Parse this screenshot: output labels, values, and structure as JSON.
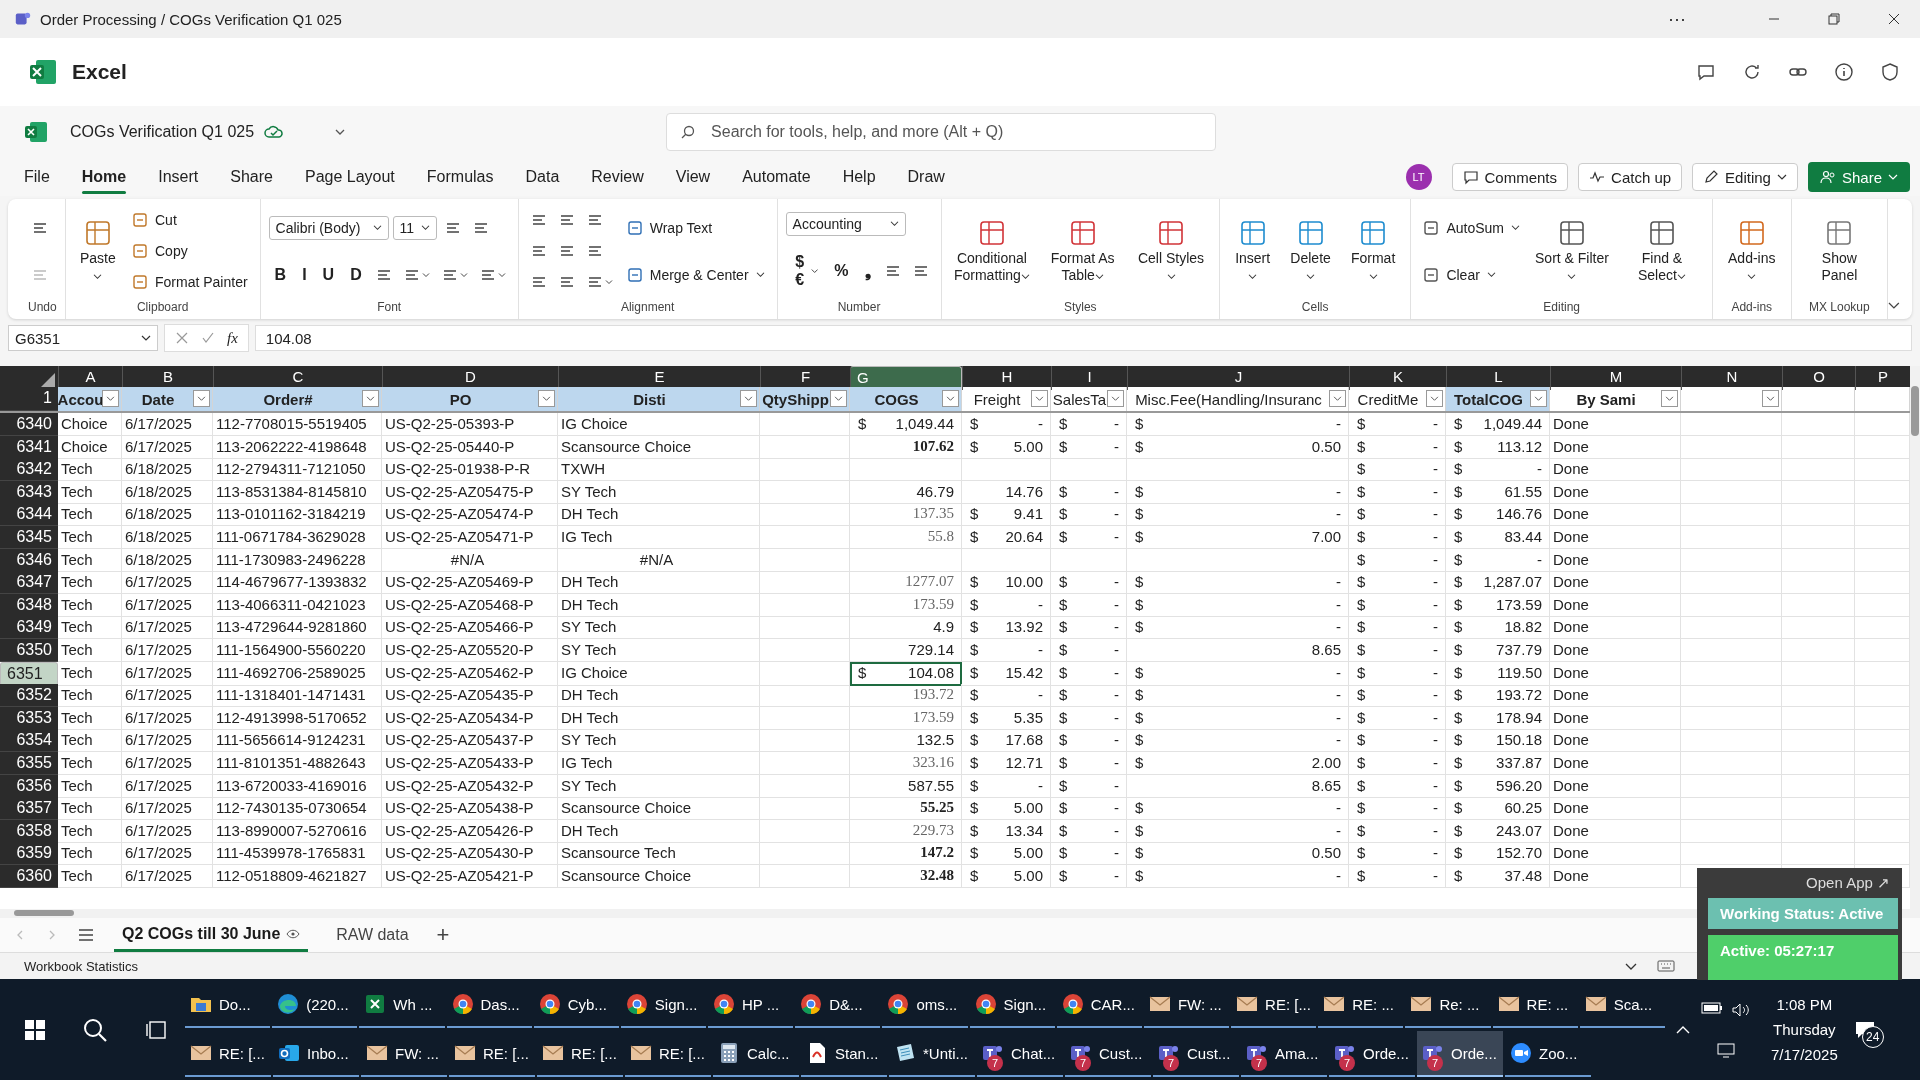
{
  "window": {
    "title": "Order Processing / COGs Verification Q1 025",
    "more": "···"
  },
  "app": {
    "name": "Excel"
  },
  "document": {
    "name": "COGs Verification Q1 025",
    "search_placeholder": "Search for tools, help, and more (Alt + Q)"
  },
  "menu": {
    "tabs": [
      {
        "label": "File",
        "selected": false
      },
      {
        "label": "Home",
        "selected": true
      },
      {
        "label": "Insert",
        "selected": false
      },
      {
        "label": "Share",
        "selected": false
      },
      {
        "label": "Page Layout",
        "selected": false
      },
      {
        "label": "Formulas",
        "selected": false
      },
      {
        "label": "Data",
        "selected": false
      },
      {
        "label": "Review",
        "selected": false
      },
      {
        "label": "View",
        "selected": false
      },
      {
        "label": "Automate",
        "selected": false
      },
      {
        "label": "Help",
        "selected": false
      },
      {
        "label": "Draw",
        "selected": false
      }
    ],
    "avatar": "LT",
    "comments": "Comments",
    "catch_up": "Catch up",
    "mode": "Editing",
    "share": "Share"
  },
  "ribbon": {
    "groups": [
      {
        "label": "Undo",
        "columns": [
          [
            [
              {
                "kind": "icon",
                "disabled": false
              }
            ],
            [
              {
                "kind": "icon",
                "disabled": true
              }
            ]
          ]
        ]
      },
      {
        "label": "Clipboard",
        "columns": [
          [
            [
              {
                "kind": "large",
                "label": "Paste",
                "dropdown": true
              }
            ]
          ],
          [
            [
              {
                "kind": "small",
                "label": "Cut"
              }
            ],
            [
              {
                "kind": "small",
                "label": "Copy"
              }
            ],
            [
              {
                "kind": "small",
                "label": "Format Painter"
              }
            ]
          ]
        ]
      },
      {
        "label": "Font",
        "columns": [
          [
            [
              {
                "kind": "select",
                "label": "Calibri (Body)",
                "wide": true
              },
              {
                "kind": "select",
                "label": "11",
                "wide": false
              },
              {
                "kind": "icon"
              },
              {
                "kind": "icon"
              }
            ],
            [
              {
                "kind": "glyph",
                "label": "B"
              },
              {
                "kind": "glyph",
                "label": "I"
              },
              {
                "kind": "glyph",
                "label": "U"
              },
              {
                "kind": "glyph",
                "label": "D"
              },
              {
                "kind": "icon"
              },
              {
                "kind": "icon",
                "dropdown": true
              },
              {
                "kind": "icon",
                "dropdown": true
              },
              {
                "kind": "icon",
                "dropdown": true
              }
            ]
          ]
        ]
      },
      {
        "label": "Alignment",
        "columns": [
          [
            [
              {
                "kind": "icon"
              },
              {
                "kind": "icon"
              },
              {
                "kind": "icon"
              }
            ],
            [
              {
                "kind": "icon"
              },
              {
                "kind": "icon"
              },
              {
                "kind": "icon"
              }
            ],
            [
              {
                "kind": "icon"
              },
              {
                "kind": "icon"
              },
              {
                "kind": "icon",
                "dropdown": true
              }
            ]
          ],
          [
            [
              {
                "kind": "small",
                "label": "Wrap Text"
              }
            ],
            [
              {
                "kind": "small",
                "label": "Merge & Center",
                "dropdown": true
              }
            ]
          ]
        ]
      },
      {
        "label": "Number",
        "columns": [
          [
            [
              {
                "kind": "select",
                "label": "Accounting",
                "wide": true
              }
            ],
            [
              {
                "kind": "glyph",
                "label": "$€",
                "dropdown": true
              },
              {
                "kind": "glyph",
                "label": "%"
              },
              {
                "kind": "glyph",
                "label": "❟"
              },
              {
                "kind": "icon"
              },
              {
                "kind": "icon"
              }
            ]
          ]
        ]
      },
      {
        "label": "Styles",
        "columns": [
          [
            [
              {
                "kind": "large",
                "label": "Conditional Formatting",
                "dropdown": true
              }
            ]
          ],
          [
            [
              {
                "kind": "large",
                "label": "Format As Table",
                "dropdown": true
              }
            ]
          ],
          [
            [
              {
                "kind": "large",
                "label": "Cell Styles",
                "dropdown": true
              }
            ]
          ]
        ]
      },
      {
        "label": "Cells",
        "columns": [
          [
            [
              {
                "kind": "large",
                "label": "Insert",
                "dropdown": true
              }
            ]
          ],
          [
            [
              {
                "kind": "large",
                "label": "Delete",
                "dropdown": true
              }
            ]
          ],
          [
            [
              {
                "kind": "large",
                "label": "Format",
                "dropdown": true
              }
            ]
          ]
        ]
      },
      {
        "label": "Editing",
        "columns": [
          [
            [
              {
                "kind": "small",
                "label": "AutoSum",
                "dropdown": true
              }
            ],
            [
              {
                "kind": "small",
                "label": "Clear",
                "dropdown": true
              }
            ]
          ],
          [
            [
              {
                "kind": "large",
                "label": "Sort & Filter",
                "dropdown": true
              }
            ]
          ],
          [
            [
              {
                "kind": "large",
                "label": "Find & Select",
                "dropdown": true
              }
            ]
          ]
        ]
      },
      {
        "label": "Add-ins",
        "columns": [
          [
            [
              {
                "kind": "large",
                "label": "Add-ins",
                "dropdown": true
              }
            ]
          ]
        ]
      },
      {
        "label": "MX Lookup",
        "columns": [
          [
            [
              {
                "kind": "large",
                "label": "Show Panel"
              }
            ]
          ]
        ]
      }
    ]
  },
  "formula_bar": {
    "cell": "G6351",
    "fx": "fx",
    "value": "104.08"
  },
  "sheet": {
    "corner_row": "1",
    "columns": [
      {
        "letter": "A",
        "header": "Accou",
        "filter": true,
        "bold": true,
        "filled": true,
        "selected": false
      },
      {
        "letter": "B",
        "header": "Date",
        "filter": true,
        "bold": true,
        "filled": true,
        "selected": false
      },
      {
        "letter": "C",
        "header": "Order#",
        "filter": true,
        "bold": true,
        "filled": true,
        "selected": false
      },
      {
        "letter": "D",
        "header": "PO",
        "filter": true,
        "bold": true,
        "filled": true,
        "selected": false
      },
      {
        "letter": "E",
        "header": "Disti",
        "filter": true,
        "bold": true,
        "filled": true,
        "selected": false
      },
      {
        "letter": "F",
        "header": "QtyShipp",
        "filter": true,
        "bold": true,
        "filled": true,
        "selected": false
      },
      {
        "letter": "G",
        "header": "COGS",
        "filter": true,
        "bold": true,
        "filled": true,
        "selected": true
      },
      {
        "letter": "H",
        "header": "Freight",
        "filter": true,
        "bold": false,
        "filled": false,
        "selected": false
      },
      {
        "letter": "I",
        "header": "SalesTa",
        "filter": true,
        "bold": false,
        "filled": false,
        "selected": false
      },
      {
        "letter": "J",
        "header": "Misc.Fee(Handling/Insuranc",
        "filter": true,
        "bold": false,
        "filled": false,
        "selected": false
      },
      {
        "letter": "K",
        "header": "CreditMe",
        "filter": true,
        "bold": false,
        "filled": false,
        "selected": false
      },
      {
        "letter": "L",
        "header": "TotalCOG",
        "filter": true,
        "bold": true,
        "filled": true,
        "selected": false
      },
      {
        "letter": "M",
        "header": "By Sami",
        "filter": true,
        "bold": true,
        "filled": false,
        "selected": false
      },
      {
        "letter": "N",
        "filter": true,
        "filled": false,
        "selected": false
      },
      {
        "letter": "O",
        "filter": false,
        "filled": false,
        "selected": false
      },
      {
        "letter": "P",
        "filter": false,
        "filled": false,
        "selected": false
      }
    ],
    "rows": [
      {
        "row": "6340",
        "selected": false,
        "cells": [
          "Choice",
          "6/17/2025",
          "112-7708015-5519405",
          "US-Q2-25-05393-P",
          "IG Choice",
          "",
          {
            "cur": "$",
            "val": "1,049.44"
          },
          {
            "cur": "$",
            "val": "-"
          },
          {
            "cur": "$",
            "val": "-"
          },
          {
            "cur": "$",
            "val": "-"
          },
          {
            "cur": "$",
            "val": "-"
          },
          {
            "cur": "$",
            "val": "1,049.44"
          },
          "Done"
        ]
      },
      {
        "row": "6341",
        "selected": false,
        "cells": [
          "Choice",
          "6/17/2025",
          "113-2062222-4198648",
          "US-Q2-25-05440-P",
          "Scansource Choice",
          "",
          {
            "val": "107.62",
            "kind": "bold"
          },
          {
            "cur": "$",
            "val": "5.00"
          },
          {
            "cur": "$",
            "val": "-"
          },
          {
            "cur": "$",
            "val": "0.50"
          },
          {
            "cur": "$",
            "val": "-"
          },
          {
            "cur": "$",
            "val": "113.12"
          },
          "Done"
        ]
      },
      {
        "row": "6342",
        "selected": false,
        "cells": [
          "Tech",
          "6/18/2025",
          "112-2794311-7121050",
          "US-Q2-25-01938-P-R",
          "TXWH",
          "",
          "",
          "",
          "",
          "",
          {
            "cur": "$",
            "val": "-"
          },
          {
            "cur": "$",
            "val": "-"
          },
          "Done"
        ]
      },
      {
        "row": "6343",
        "selected": false,
        "cells": [
          "Tech",
          "6/18/2025",
          "113-8531384-8145810",
          "US-Q2-25-AZ05475-P",
          "SY Tech",
          "",
          {
            "val": "46.79"
          },
          {
            "val": "14.76"
          },
          {
            "cur": "$",
            "val": "-"
          },
          {
            "cur": "$",
            "val": "-"
          },
          {
            "cur": "$",
            "val": "-"
          },
          {
            "cur": "$",
            "val": "61.55"
          },
          "Done"
        ]
      },
      {
        "row": "6344",
        "selected": false,
        "cells": [
          "Tech",
          "6/18/2025",
          "113-0101162-3184219",
          "US-Q2-25-AZ05474-P",
          "DH Tech",
          "",
          {
            "val": "137.35",
            "kind": "serif"
          },
          {
            "cur": "$",
            "val": "9.41"
          },
          {
            "cur": "$",
            "val": "-"
          },
          {
            "cur": "$",
            "val": "-"
          },
          {
            "cur": "$",
            "val": "-"
          },
          {
            "cur": "$",
            "val": "146.76"
          },
          "Done"
        ]
      },
      {
        "row": "6345",
        "selected": false,
        "cells": [
          "Tech",
          "6/18/2025",
          "111-0671784-3629028",
          "US-Q2-25-AZ05471-P",
          "IG Tech",
          "",
          {
            "val": "55.8",
            "kind": "serif"
          },
          {
            "cur": "$",
            "val": "20.64"
          },
          {
            "cur": "$",
            "val": "-"
          },
          {
            "cur": "$",
            "val": "7.00"
          },
          {
            "cur": "$",
            "val": "-"
          },
          {
            "cur": "$",
            "val": "83.44"
          },
          "Done"
        ]
      },
      {
        "row": "6346",
        "selected": false,
        "cells": [
          "Tech",
          "6/18/2025",
          "111-1730983-2496228",
          {
            "val": "#N/A",
            "kind": "error"
          },
          {
            "val": "#N/A",
            "kind": "error"
          },
          "",
          "",
          "",
          "",
          "",
          {
            "cur": "$",
            "val": "-"
          },
          {
            "cur": "$",
            "val": "-"
          },
          "Done"
        ]
      },
      {
        "row": "6347",
        "selected": false,
        "cells": [
          "Tech",
          "6/17/2025",
          "114-4679677-1393832",
          "US-Q2-25-AZ05469-P",
          "DH Tech",
          "",
          {
            "val": "1277.07",
            "kind": "serif"
          },
          {
            "cur": "$",
            "val": "10.00"
          },
          {
            "cur": "$",
            "val": "-"
          },
          {
            "cur": "$",
            "val": "-"
          },
          {
            "cur": "$",
            "val": "-"
          },
          {
            "cur": "$",
            "val": "1,287.07"
          },
          "Done"
        ]
      },
      {
        "row": "6348",
        "selected": false,
        "cells": [
          "Tech",
          "6/17/2025",
          "113-4066311-0421023",
          "US-Q2-25-AZ05468-P",
          "DH Tech",
          "",
          {
            "val": "173.59",
            "kind": "serif"
          },
          {
            "cur": "$",
            "val": "-"
          },
          {
            "cur": "$",
            "val": "-"
          },
          {
            "cur": "$",
            "val": "-"
          },
          {
            "cur": "$",
            "val": "-"
          },
          {
            "cur": "$",
            "val": "173.59"
          },
          "Done"
        ]
      },
      {
        "row": "6349",
        "selected": false,
        "cells": [
          "Tech",
          "6/17/2025",
          "113-4729644-9281860",
          "US-Q2-25-AZ05466-P",
          "SY Tech",
          "",
          {
            "val": "4.9"
          },
          {
            "cur": "$",
            "val": "13.92"
          },
          {
            "cur": "$",
            "val": "-"
          },
          {
            "cur": "$",
            "val": "-"
          },
          {
            "cur": "$",
            "val": "-"
          },
          {
            "cur": "$",
            "val": "18.82"
          },
          "Done"
        ]
      },
      {
        "row": "6350",
        "selected": false,
        "cells": [
          "Tech",
          "6/17/2025",
          "111-1564900-5560220",
          "US-Q2-25-AZ05520-P",
          "SY Tech",
          "",
          {
            "val": "729.14"
          },
          {
            "cur": "$",
            "val": "-"
          },
          {
            "cur": "$",
            "val": "-"
          },
          {
            "val": "8.65"
          },
          {
            "cur": "$",
            "val": "-"
          },
          {
            "cur": "$",
            "val": "737.79"
          },
          "Done"
        ]
      },
      {
        "row": "6351",
        "selected": true,
        "cells": [
          "Tech",
          "6/17/2025",
          "111-4692706-2589025",
          "US-Q2-25-AZ05462-P",
          "IG Choice",
          "",
          {
            "cur": "$",
            "val": "104.08"
          },
          {
            "cur": "$",
            "val": "15.42"
          },
          {
            "cur": "$",
            "val": "-"
          },
          {
            "cur": "$",
            "val": "-"
          },
          {
            "cur": "$",
            "val": "-"
          },
          {
            "cur": "$",
            "val": "119.50"
          },
          "Done"
        ]
      },
      {
        "row": "6352",
        "selected": false,
        "cells": [
          "Tech",
          "6/17/2025",
          "111-1318401-1471431",
          "US-Q2-25-AZ05435-P",
          "DH Tech",
          "",
          {
            "val": "193.72",
            "kind": "serif"
          },
          {
            "cur": "$",
            "val": "-"
          },
          {
            "cur": "$",
            "val": "-"
          },
          {
            "cur": "$",
            "val": "-"
          },
          {
            "cur": "$",
            "val": "-"
          },
          {
            "cur": "$",
            "val": "193.72"
          },
          "Done"
        ]
      },
      {
        "row": "6353",
        "selected": false,
        "cells": [
          "Tech",
          "6/17/2025",
          "112-4913998-5170652",
          "US-Q2-25-AZ05434-P",
          "DH Tech",
          "",
          {
            "val": "173.59",
            "kind": "serif"
          },
          {
            "cur": "$",
            "val": "5.35"
          },
          {
            "cur": "$",
            "val": "-"
          },
          {
            "cur": "$",
            "val": "-"
          },
          {
            "cur": "$",
            "val": "-"
          },
          {
            "cur": "$",
            "val": "178.94"
          },
          "Done"
        ]
      },
      {
        "row": "6354",
        "selected": false,
        "cells": [
          "Tech",
          "6/17/2025",
          "111-5656614-9124231",
          "US-Q2-25-AZ05437-P",
          "SY Tech",
          "",
          {
            "val": "132.5"
          },
          {
            "cur": "$",
            "val": "17.68"
          },
          {
            "cur": "$",
            "val": "-"
          },
          {
            "cur": "$",
            "val": "-"
          },
          {
            "cur": "$",
            "val": "-"
          },
          {
            "cur": "$",
            "val": "150.18"
          },
          "Done"
        ]
      },
      {
        "row": "6355",
        "selected": false,
        "cells": [
          "Tech",
          "6/17/2025",
          "111-8101351-4882643",
          "US-Q2-25-AZ05433-P",
          "IG Tech",
          "",
          {
            "val": "323.16",
            "kind": "serif"
          },
          {
            "cur": "$",
            "val": "12.71"
          },
          {
            "cur": "$",
            "val": "-"
          },
          {
            "cur": "$",
            "val": "2.00"
          },
          {
            "cur": "$",
            "val": "-"
          },
          {
            "cur": "$",
            "val": "337.87"
          },
          "Done"
        ]
      },
      {
        "row": "6356",
        "selected": false,
        "cells": [
          "Tech",
          "6/17/2025",
          "113-6720033-4169016",
          "US-Q2-25-AZ05432-P",
          "SY Tech",
          "",
          {
            "val": "587.55"
          },
          {
            "cur": "$",
            "val": "-"
          },
          {
            "cur": "$",
            "val": "-"
          },
          {
            "val": "8.65"
          },
          {
            "cur": "$",
            "val": "-"
          },
          {
            "cur": "$",
            "val": "596.20"
          },
          "Done"
        ]
      },
      {
        "row": "6357",
        "selected": false,
        "cells": [
          "Tech",
          "6/17/2025",
          "112-7430135-0730654",
          "US-Q2-25-AZ05438-P",
          "Scansource Choice",
          "",
          {
            "val": "55.25",
            "kind": "bold"
          },
          {
            "cur": "$",
            "val": "5.00"
          },
          {
            "cur": "$",
            "val": "-"
          },
          {
            "cur": "$",
            "val": "-"
          },
          {
            "cur": "$",
            "val": "-"
          },
          {
            "cur": "$",
            "val": "60.25"
          },
          "Done"
        ]
      },
      {
        "row": "6358",
        "selected": false,
        "cells": [
          "Tech",
          "6/17/2025",
          "113-8990007-5270616",
          "US-Q2-25-AZ05426-P",
          "DH Tech",
          "",
          {
            "val": "229.73",
            "kind": "serif"
          },
          {
            "cur": "$",
            "val": "13.34"
          },
          {
            "cur": "$",
            "val": "-"
          },
          {
            "cur": "$",
            "val": "-"
          },
          {
            "cur": "$",
            "val": "-"
          },
          {
            "cur": "$",
            "val": "243.07"
          },
          "Done"
        ]
      },
      {
        "row": "6359",
        "selected": false,
        "cells": [
          "Tech",
          "6/17/2025",
          "111-4539978-1765831",
          "US-Q2-25-AZ05430-P",
          "Scansource Tech",
          "",
          {
            "val": "147.2",
            "kind": "bold"
          },
          {
            "cur": "$",
            "val": "5.00"
          },
          {
            "cur": "$",
            "val": "-"
          },
          {
            "cur": "$",
            "val": "0.50"
          },
          {
            "cur": "$",
            "val": "-"
          },
          {
            "cur": "$",
            "val": "152.70"
          },
          "Done"
        ]
      },
      {
        "row": "6360",
        "selected": false,
        "cells": [
          "Tech",
          "6/17/2025",
          "112-0518809-4621827",
          "US-Q2-25-AZ05421-P",
          "Scansource Choice",
          "",
          {
            "val": "32.48",
            "kind": "bold"
          },
          {
            "cur": "$",
            "val": "5.00"
          },
          {
            "cur": "$",
            "val": "-"
          },
          {
            "cur": "$",
            "val": "-"
          },
          {
            "cur": "$",
            "val": "-"
          },
          {
            "cur": "$",
            "val": "37.48"
          },
          "Done"
        ]
      }
    ]
  },
  "sheet_tabs": [
    {
      "label": "Q2 COGs till 30 June",
      "selected": true
    },
    {
      "label": "RAW data",
      "selected": false
    }
  ],
  "add_sheet": "+",
  "status_bar": {
    "text": "Workbook Statistics"
  },
  "widget": {
    "open_app": "Open App ↗",
    "status": "Working Status: Active",
    "timer": "Active: 05:27:17"
  },
  "taskbar": {
    "rows": [
      [
        {
          "kind": "folder",
          "label": "Do..."
        },
        {
          "kind": "edge",
          "label": "(220..."
        },
        {
          "kind": "excel",
          "label": "Wh ..."
        },
        {
          "kind": "chrome",
          "label": "Das..."
        },
        {
          "kind": "chrome",
          "label": "Cyb..."
        },
        {
          "kind": "chrome",
          "label": "Sign..."
        },
        {
          "kind": "chrome",
          "label": "HP ..."
        },
        {
          "kind": "chrome",
          "label": "D&..."
        },
        {
          "kind": "chrome",
          "label": "oms..."
        },
        {
          "kind": "chrome",
          "label": "Sign..."
        },
        {
          "kind": "chrome",
          "label": "CAR..."
        },
        {
          "kind": "mail",
          "label": "FW: ..."
        },
        {
          "kind": "mail",
          "label": "RE: [..."
        },
        {
          "kind": "mail",
          "label": "RE: ..."
        },
        {
          "kind": "mail",
          "label": "Re: ..."
        },
        {
          "kind": "mail",
          "label": "RE: ..."
        },
        {
          "kind": "mail",
          "label": "Sca..."
        }
      ],
      [
        {
          "kind": "mail",
          "label": "RE: [..."
        },
        {
          "kind": "outlook",
          "label": "Inbo..."
        },
        {
          "kind": "mail",
          "label": "FW: ..."
        },
        {
          "kind": "mail",
          "label": "RE: [..."
        },
        {
          "kind": "mail",
          "label": "RE: [..."
        },
        {
          "kind": "mail",
          "label": "RE: [..."
        },
        {
          "kind": "calc",
          "label": "Calc..."
        },
        {
          "kind": "pdf",
          "label": "Stan..."
        },
        {
          "kind": "notepad",
          "label": "*Unti..."
        },
        {
          "kind": "teams",
          "label": "Chat...",
          "badge": "7"
        },
        {
          "kind": "teams",
          "label": "Cust...",
          "badge": "7"
        },
        {
          "kind": "teams",
          "label": "Cust...",
          "badge": "7"
        },
        {
          "kind": "teams",
          "label": "Ama...",
          "badge": "7"
        },
        {
          "kind": "teams",
          "label": "Orde...",
          "badge": "7"
        },
        {
          "kind": "teams",
          "label": "Orde...",
          "badge": "7",
          "selected": true
        },
        {
          "kind": "zoom",
          "label": "Zoo..."
        }
      ]
    ],
    "time": "1:08 PM",
    "day": "Thursday",
    "date": "7/17/2025",
    "notifications": "24"
  }
}
